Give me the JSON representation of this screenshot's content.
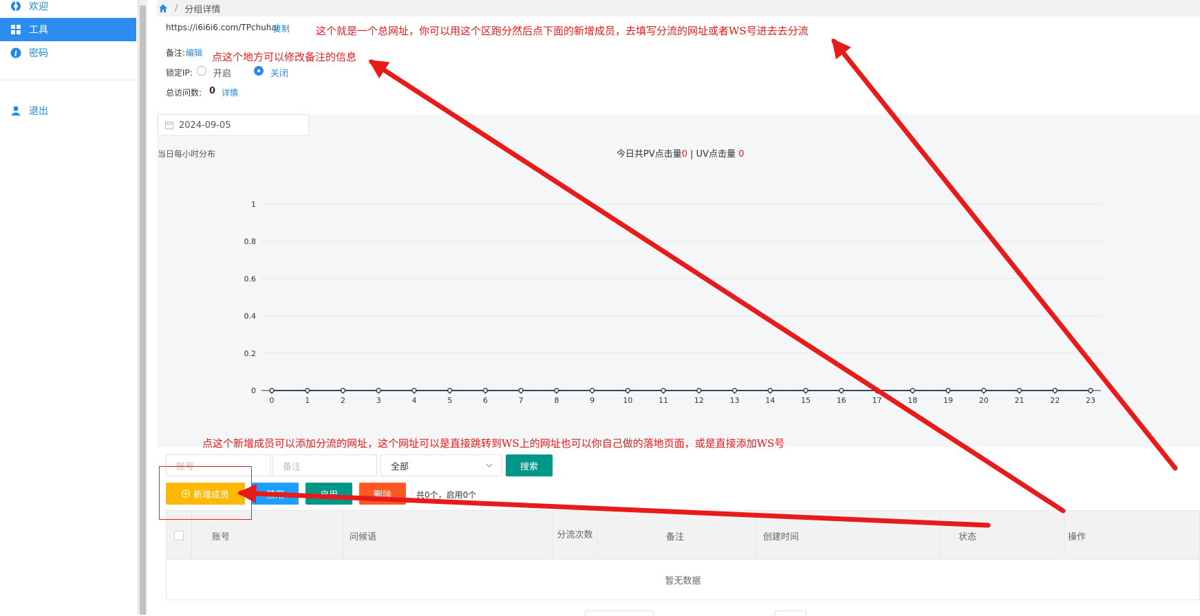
{
  "sidebar": {
    "items": [
      {
        "label": "欢迎",
        "icon": "welcome-icon"
      },
      {
        "label": "工具",
        "icon": "grid-icon"
      },
      {
        "label": "密码",
        "icon": "info-icon"
      },
      {
        "label": "退出",
        "icon": "user-icon"
      }
    ],
    "active_index": 1
  },
  "breadcrumb": {
    "home_icon": "home-icon",
    "separator": "/",
    "current": "分组详情"
  },
  "group": {
    "url": "https://i6i6i6.com/TPchuhai",
    "copy_label": "复制",
    "remark_label": "备注:",
    "remark_edit": "编辑",
    "lock_ip_label": "锁定IP:",
    "lock_on": "开启",
    "lock_off": "关闭",
    "lock_selected": "关闭",
    "total_visits_label": "总访问数:",
    "total_visits_value": "0",
    "details_link": "详情"
  },
  "date_filter": {
    "value": "2024-09-05",
    "icon": "calendar-icon"
  },
  "chart_header": {
    "left_label": "当日每小时分布",
    "pv_label": "今日共PV点击量",
    "pv_value": "0",
    "separator": " | ",
    "uv_label": "UV点击量 ",
    "uv_value": "0"
  },
  "chart_data": {
    "type": "line",
    "x": [
      0,
      1,
      2,
      3,
      4,
      5,
      6,
      7,
      8,
      9,
      10,
      11,
      12,
      13,
      14,
      15,
      16,
      17,
      18,
      19,
      20,
      21,
      22,
      23
    ],
    "series": [
      {
        "values": [
          0,
          0,
          0,
          0,
          0,
          0,
          0,
          0,
          0,
          0,
          0,
          0,
          0,
          0,
          0,
          0,
          0,
          0,
          0,
          0,
          0,
          0,
          0,
          0
        ]
      }
    ],
    "ylim": [
      0,
      1
    ],
    "yticks": [
      "0",
      "0.2",
      "0.4",
      "0.6",
      "0.8",
      "1"
    ],
    "grid": true
  },
  "filters": {
    "account_placeholder": "账号",
    "remark_placeholder": "备注",
    "status_select": "全部",
    "search_button": "搜索"
  },
  "actions": {
    "add_member": "新增成员",
    "disable": "禁用",
    "enable": "启用",
    "delete": "删除",
    "summary": "共0个，启用0个"
  },
  "table": {
    "columns": [
      "账号",
      "问候语",
      "分流次数",
      "备注",
      "创建时间",
      "状态",
      "操作"
    ],
    "empty_text": "暂无数据"
  },
  "annotations": {
    "note_url": "这个就是一个总网址，你可以用这个区跑分然后点下面的新增成员，去填写分流的网址或者WS号进去去分流",
    "note_remark": "点这个地方可以修改备注的信息",
    "note_add": "点这个新增成员可以添加分流的网址，这个网址可以是直接跳转到WS上的网址也可以你自己做的落地页面，或是直接添加WS号"
  },
  "colors": {
    "primary": "#2d8cf0",
    "accent_green": "#009688",
    "warning": "#ffb800",
    "danger": "#ff5722",
    "annotation_red": "#e81a1a"
  }
}
